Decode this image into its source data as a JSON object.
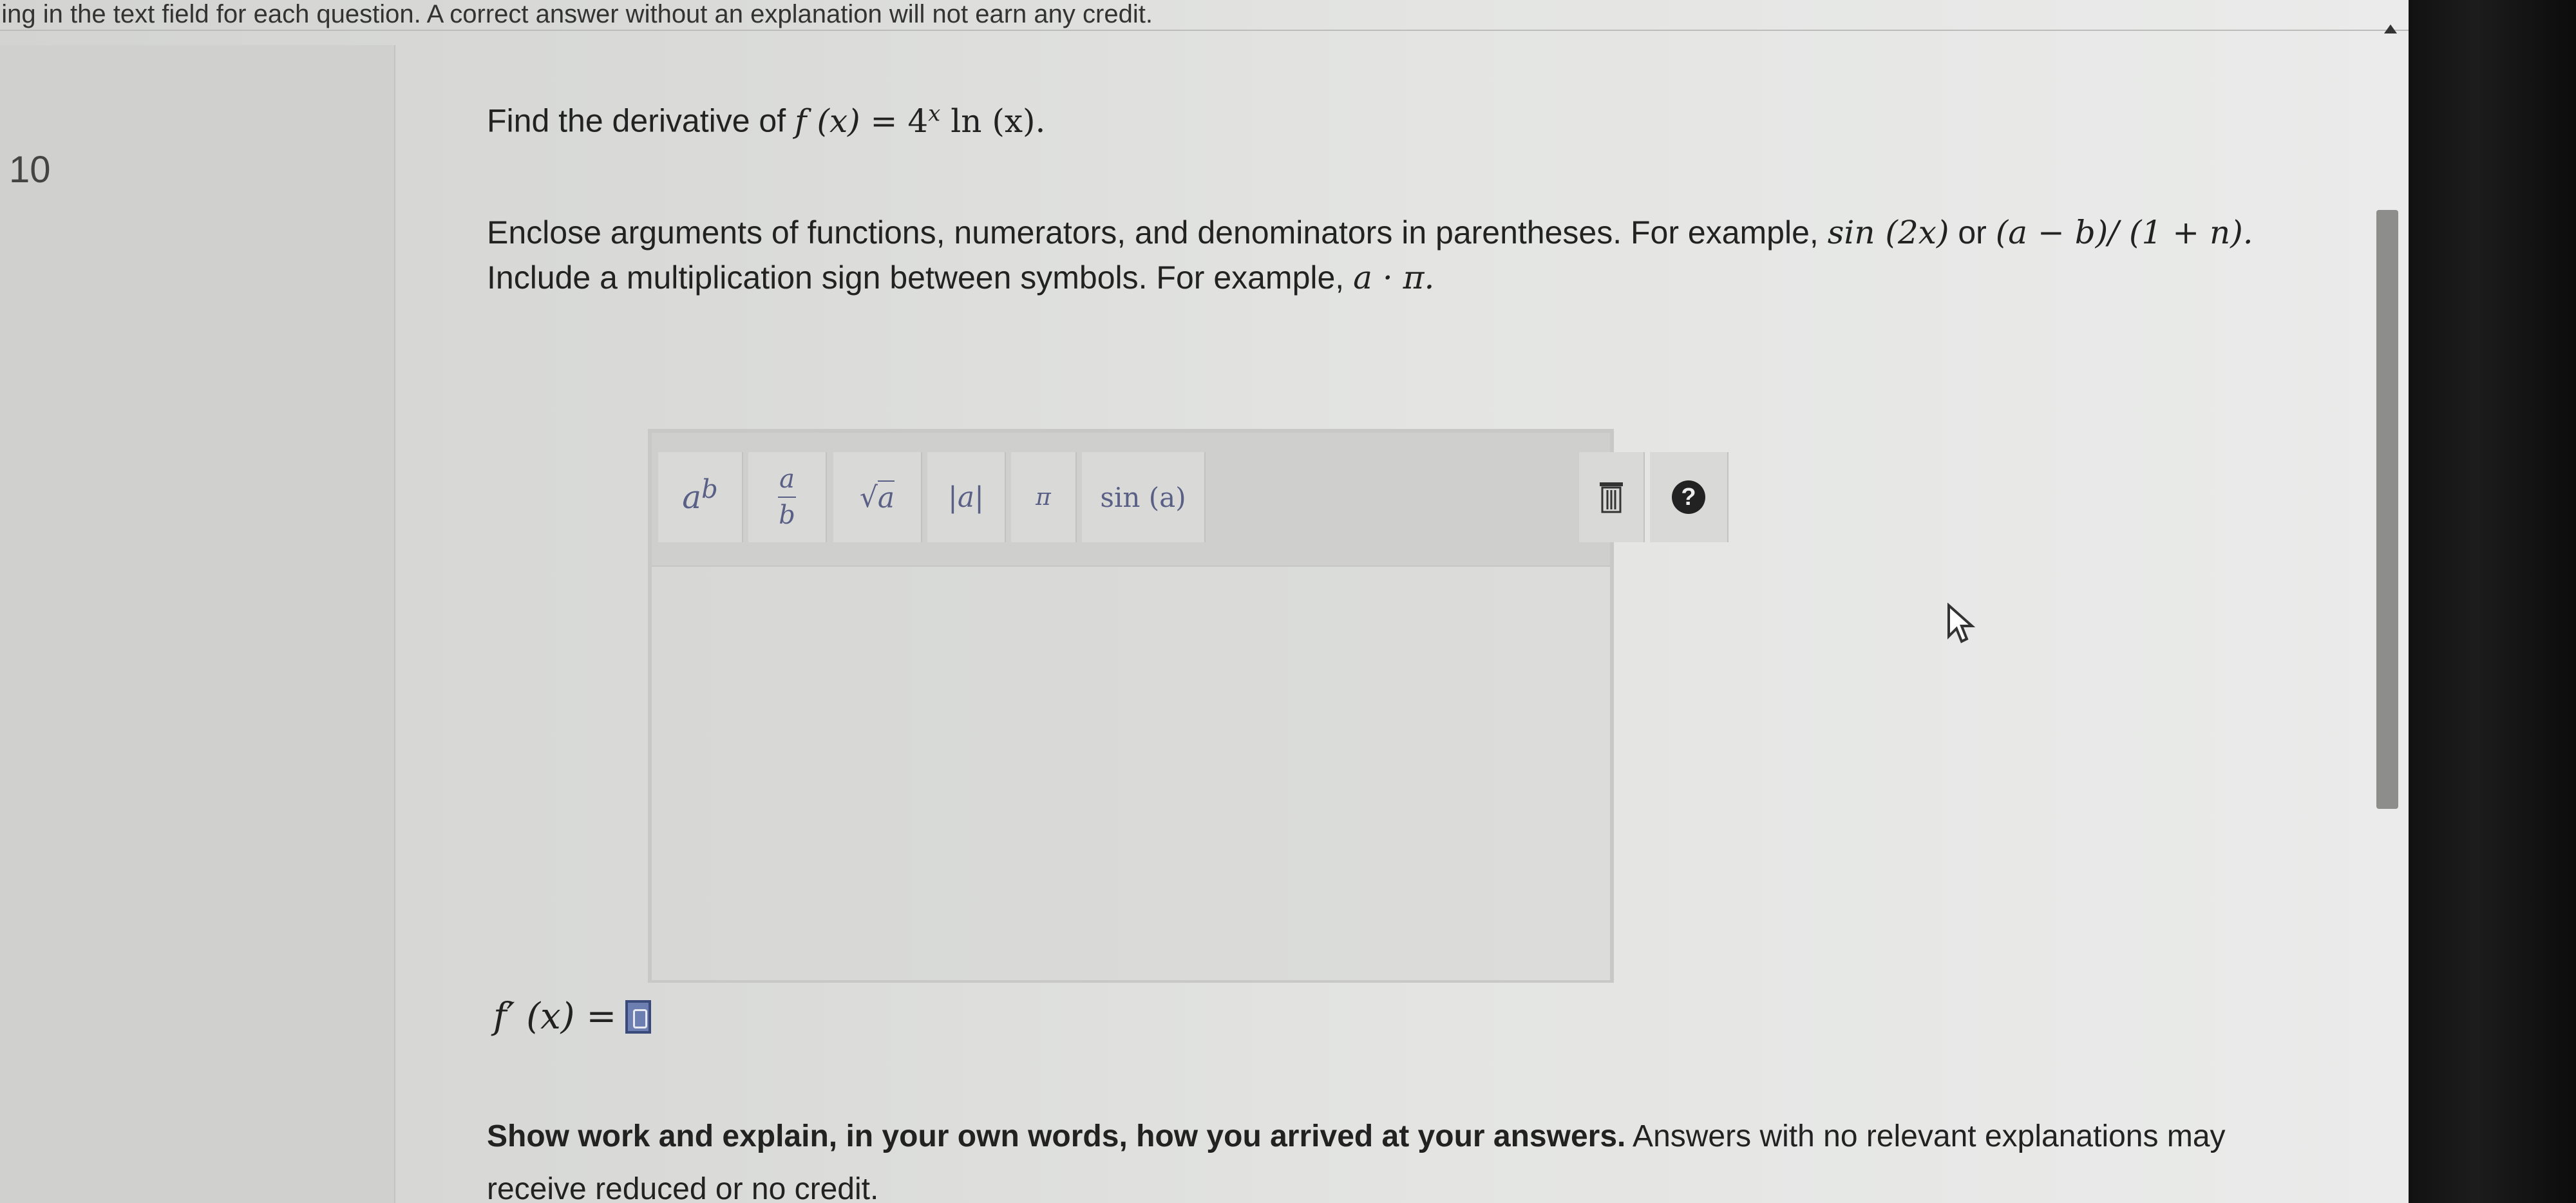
{
  "top_instructions": "ning in the text field for each question. A correct answer without an explanation will not earn any credit.",
  "question": {
    "number": "10",
    "prompt_text": "Find the derivative of",
    "function_lhs": "f (x) =",
    "function_base": "4",
    "function_exp": "x",
    "function_tail": " ln (x)."
  },
  "instructions": {
    "line1_a": "Enclose arguments of functions, numerators, and denominators in parentheses. For example,",
    "line1_ex1": "sin (2x)",
    "line1_or": "or",
    "line1_ex2": "(a − b)/ (1 + n).",
    "line2_a": "Include a multiplication sign between symbols. For example,",
    "line2_ex": "a · π."
  },
  "toolbar": {
    "power_base": "a",
    "power_exp": "b",
    "fraction_num": "a",
    "fraction_den": "b",
    "sqrt_symbol": "√",
    "sqrt_arg": "a",
    "abs_label": "|a|",
    "pi_label": "π",
    "sin_label": "sin (a)",
    "help_label": "?"
  },
  "answer": {
    "label": "f′ (x) ="
  },
  "show_work": {
    "bold": "Show work and explain, in your own words, how you arrived at your answers.",
    "normal": " Answers with no relevant explanations may receive reduced or no credit."
  },
  "icons": [
    "trash-icon",
    "help-icon",
    "scroll-up-icon",
    "mouse-cursor-icon",
    "answer-input-icon"
  ]
}
